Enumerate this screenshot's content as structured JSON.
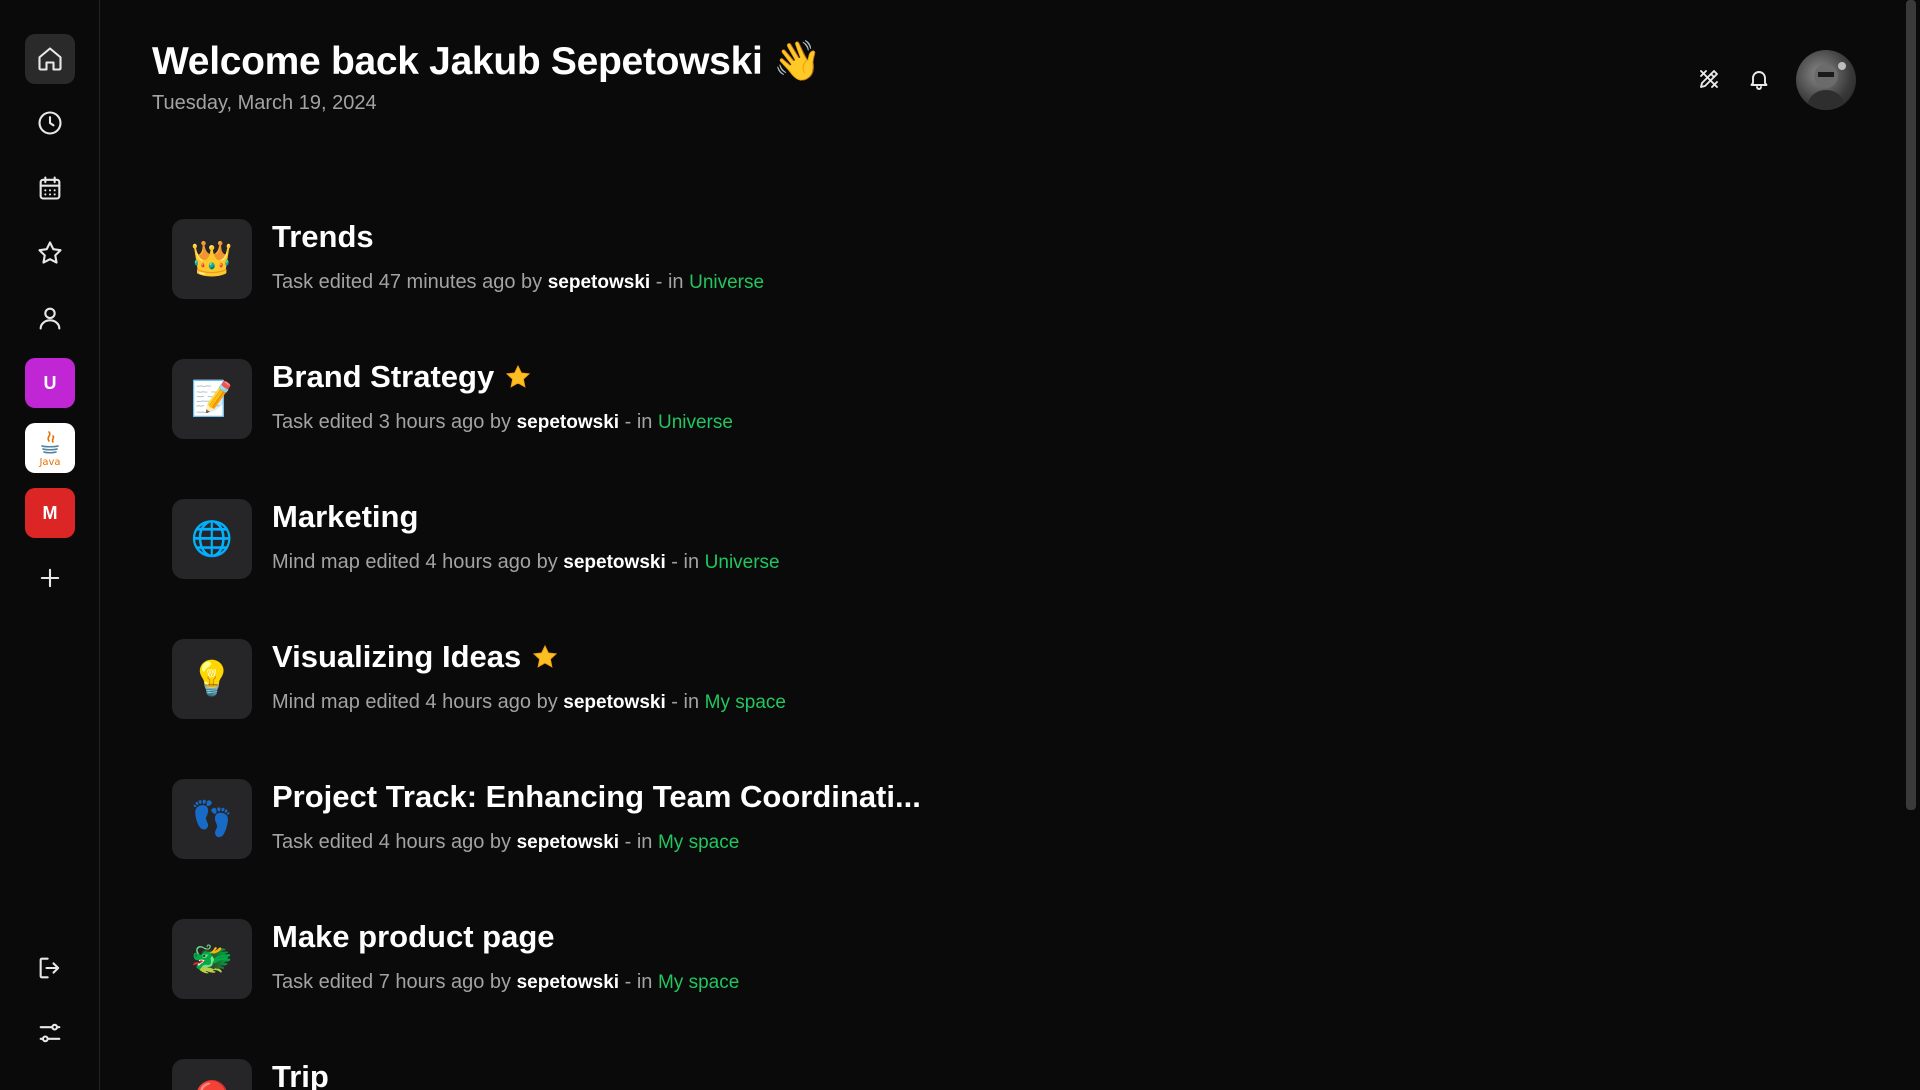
{
  "header": {
    "greeting": "Welcome back Jakub Sepetowski",
    "wave_emoji": "👋",
    "date": "Tuesday, March 19, 2024"
  },
  "sidebar": {
    "nav": [
      {
        "name": "home-icon"
      },
      {
        "name": "clock-icon"
      },
      {
        "name": "calendar-icon"
      },
      {
        "name": "star-icon"
      },
      {
        "name": "user-icon"
      }
    ],
    "spaces": [
      {
        "label": "U",
        "color": "#c026d3"
      },
      {
        "label": "Java",
        "color": "#ffffff"
      },
      {
        "label": "M",
        "color": "#dc2626"
      }
    ]
  },
  "items": [
    {
      "icon": "👑",
      "title": "Trends",
      "starred": false,
      "action": "Task edited 47 minutes ago by",
      "user": "sepetowski",
      "sep": "- in",
      "space": "Universe"
    },
    {
      "icon": "📝",
      "title": "Brand Strategy",
      "starred": true,
      "action": "Task edited 3 hours ago by",
      "user": "sepetowski",
      "sep": "- in",
      "space": "Universe"
    },
    {
      "icon": "🌐",
      "title": "Marketing",
      "starred": false,
      "action": "Mind map edited 4 hours ago by",
      "user": "sepetowski",
      "sep": "- in",
      "space": "Universe"
    },
    {
      "icon": "💡",
      "title": "Visualizing Ideas",
      "starred": true,
      "action": "Mind map edited 4 hours ago by",
      "user": "sepetowski",
      "sep": "- in",
      "space": "My space"
    },
    {
      "icon": "👣",
      "title": "Project Track: Enhancing Team Coordinati...",
      "starred": false,
      "action": "Task edited 4 hours ago by",
      "user": "sepetowski",
      "sep": "- in",
      "space": "My space"
    },
    {
      "icon": "🐲",
      "title": "Make product page",
      "starred": false,
      "action": "Task edited 7 hours ago by",
      "user": "sepetowski",
      "sep": "- in",
      "space": "My space"
    },
    {
      "icon": "🔴",
      "title": "Trip",
      "starred": false,
      "action": "",
      "user": "",
      "sep": "",
      "space": ""
    }
  ],
  "colors": {
    "accent_green": "#22c55e",
    "background": "#0a0a0a",
    "card": "#262629",
    "star": "#fbbf24"
  }
}
